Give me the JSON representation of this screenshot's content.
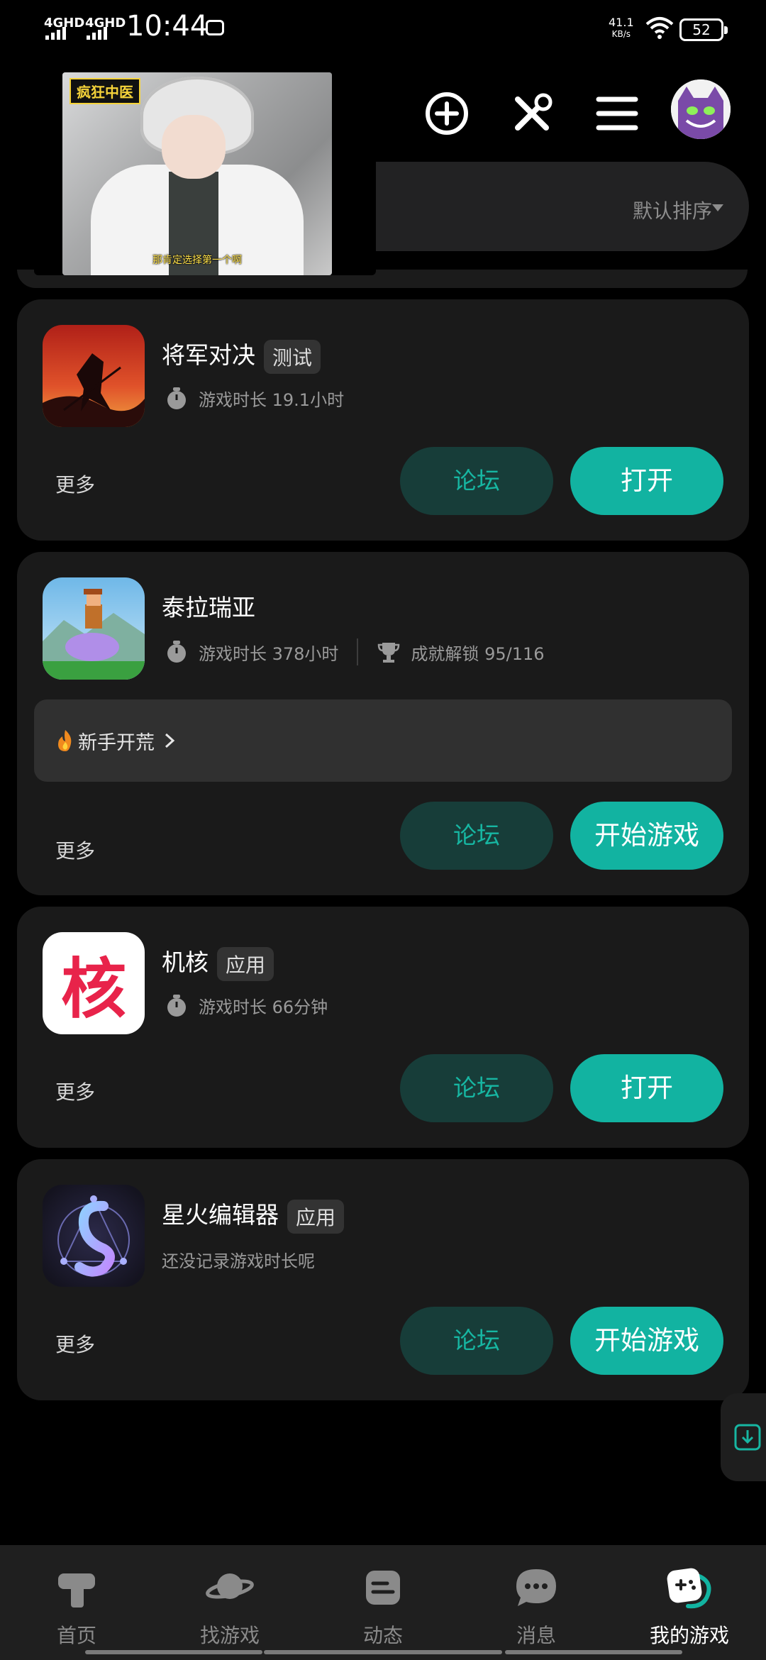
{
  "status_bar": {
    "network1": "4GHD",
    "network2": "4GHD",
    "time": "10:44",
    "speed_value": "41.1",
    "speed_unit": "KB/s",
    "battery": "52"
  },
  "video": {
    "title": "疯狂中医",
    "caption": "那肯定选择第一个啊"
  },
  "sort": {
    "label": "默认排序"
  },
  "cards": [
    {
      "name": "将军对决",
      "tag": "测试",
      "playtime": "游戏时长 19.1小时",
      "more": "更多",
      "forum": "论坛",
      "action": "打开"
    },
    {
      "name": "泰拉瑞亚",
      "playtime": "游戏时长 378小时",
      "achievements": "成就解锁 95/116",
      "guide": "新手开荒",
      "more": "更多",
      "forum": "论坛",
      "action": "开始游戏"
    },
    {
      "name": "机核",
      "tag": "应用",
      "icon_text": "核",
      "playtime": "游戏时长 66分钟",
      "more": "更多",
      "forum": "论坛",
      "action": "打开"
    },
    {
      "name": "星火编辑器",
      "tag": "应用",
      "playtime": "还没记录游戏时长呢",
      "more": "更多",
      "forum": "论坛",
      "action": "开始游戏"
    }
  ],
  "nav": [
    {
      "label": "首页",
      "icon": "home-icon"
    },
    {
      "label": "找游戏",
      "icon": "planet-icon"
    },
    {
      "label": "动态",
      "icon": "feed-icon"
    },
    {
      "label": "消息",
      "icon": "chat-icon"
    },
    {
      "label": "我的游戏",
      "icon": "gamepad-icon"
    }
  ],
  "colors": {
    "accent": "#12b3a1",
    "forum_bg": "#173d39",
    "card_bg": "#1a1a1a"
  }
}
